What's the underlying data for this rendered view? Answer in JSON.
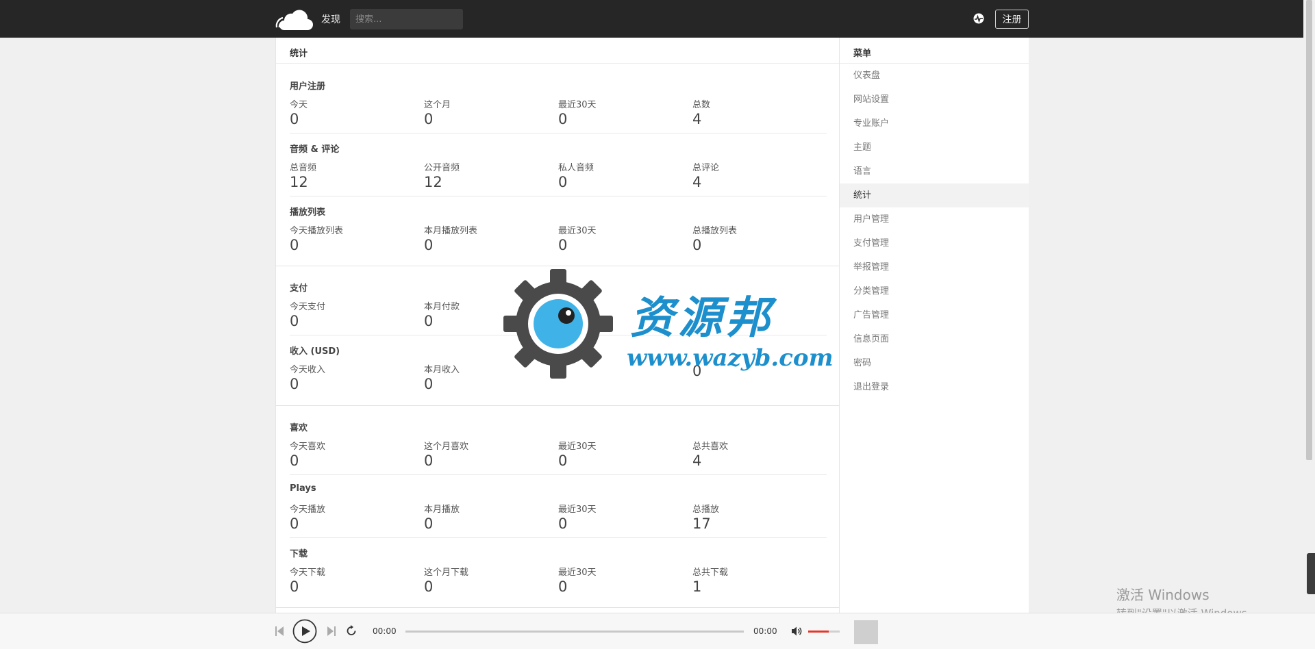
{
  "header": {
    "nav_discover": "发现",
    "search_placeholder": "搜索...",
    "register_label": "注册"
  },
  "main": {
    "title": "统计",
    "sections": [
      {
        "title": "用户注册",
        "stats": [
          {
            "label": "今天",
            "value": "0"
          },
          {
            "label": "这个月",
            "value": "0"
          },
          {
            "label": "最近30天",
            "value": "0"
          },
          {
            "label": "总数",
            "value": "4"
          }
        ]
      },
      {
        "title": "音频 & 评论",
        "stats": [
          {
            "label": "总音频",
            "value": "12"
          },
          {
            "label": "公开音频",
            "value": "12"
          },
          {
            "label": "私人音频",
            "value": "0"
          },
          {
            "label": "总评论",
            "value": "4"
          }
        ]
      },
      {
        "title": "播放列表",
        "stats": [
          {
            "label": "今天播放列表",
            "value": "0"
          },
          {
            "label": "本月播放列表",
            "value": "0"
          },
          {
            "label": "最近30天",
            "value": "0"
          },
          {
            "label": "总播放列表",
            "value": "0"
          }
        ]
      },
      {
        "title": "支付",
        "stats": [
          {
            "label": "今天支付",
            "value": "0"
          },
          {
            "label": "本月付款",
            "value": "0"
          },
          {
            "label": "",
            "value": ""
          },
          {
            "label": "",
            "value": ""
          }
        ]
      },
      {
        "title": "收入 (USD)",
        "stats": [
          {
            "label": "今天收入",
            "value": "0"
          },
          {
            "label": "本月收入",
            "value": "0"
          },
          {
            "label": "",
            "value": "0"
          },
          {
            "label": "",
            "value": "0"
          }
        ]
      },
      {
        "title": "喜欢",
        "stats": [
          {
            "label": "今天喜欢",
            "value": "0"
          },
          {
            "label": "这个月喜欢",
            "value": "0"
          },
          {
            "label": "最近30天",
            "value": "0"
          },
          {
            "label": "总共喜欢",
            "value": "4"
          }
        ]
      },
      {
        "title": "Plays",
        "stats": [
          {
            "label": "今天播放",
            "value": "0"
          },
          {
            "label": "本月播放",
            "value": "0"
          },
          {
            "label": "最近30天",
            "value": "0"
          },
          {
            "label": "总播放",
            "value": "17"
          }
        ]
      },
      {
        "title": "下载",
        "stats": [
          {
            "label": "今天下载",
            "value": "0"
          },
          {
            "label": "这个月下载",
            "value": "0"
          },
          {
            "label": "最近30天",
            "value": "0"
          },
          {
            "label": "总共下载",
            "value": "1"
          }
        ]
      }
    ]
  },
  "sidebar": {
    "title": "菜单",
    "items": [
      "仪表盘",
      "网站设置",
      "专业账户",
      "主题",
      "语言",
      "统计",
      "用户管理",
      "支付管理",
      "举报管理",
      "分类管理",
      "广告管理",
      "信息页面",
      "密码",
      "退出登录"
    ],
    "active_item": "统计"
  },
  "watermark": {
    "text": "资源邦",
    "url": "www.wazyb.com"
  },
  "windows_activation": {
    "line1": "激活 Windows",
    "line2": "转到\"设置\"以激活 Windows。"
  },
  "player": {
    "current_time": "00:00",
    "duration": "00:00",
    "volume_fraction": 0.65
  },
  "colors": {
    "topbar": "#262626",
    "accent_volume": "#e8342a",
    "watermark_blue": "#1d8fcc"
  },
  "icons": [
    "cloud-logo-icon",
    "pulse-icon",
    "previous-icon",
    "play-icon",
    "next-icon",
    "repeat-icon",
    "volume-icon",
    "gear-logo-icon"
  ]
}
